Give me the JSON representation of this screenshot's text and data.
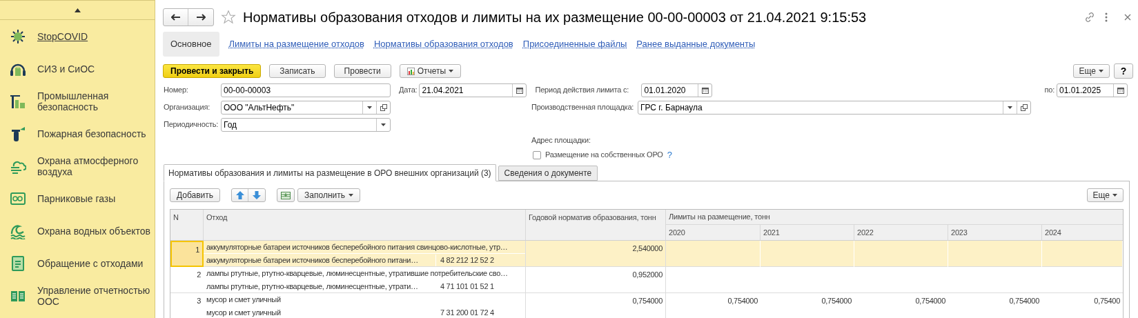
{
  "sidebar": {
    "items": [
      {
        "label": "StopCOVID",
        "selected": true
      },
      {
        "label": "СИЗ и СиОС",
        "selected": false
      },
      {
        "label": "Промышленная безопасность",
        "selected": false
      },
      {
        "label": "Пожарная безопасность",
        "selected": false
      },
      {
        "label": "Охрана атмосферного воздуха",
        "selected": false
      },
      {
        "label": "Парниковые газы",
        "selected": false
      },
      {
        "label": "Охрана водных объектов",
        "selected": false
      },
      {
        "label": "Обращение с отходами",
        "selected": false
      },
      {
        "label": "Управление отчетностью ООС",
        "selected": false
      }
    ]
  },
  "window": {
    "title": "Нормативы образования отходов и лимиты на их размещение 00-00-00003 от 21.04.2021 9:15:53"
  },
  "nav_tabs": [
    {
      "label": "Основное",
      "selected": true
    },
    {
      "label": "Лимиты на размещение отходов",
      "selected": false
    },
    {
      "label": "Нормативы образования отходов",
      "selected": false
    },
    {
      "label": "Присоединенные файлы",
      "selected": false
    },
    {
      "label": "Ранее выданные документы",
      "selected": false
    }
  ],
  "toolbar": {
    "buttons": [
      {
        "label": "Провести и закрыть",
        "kind": "default"
      },
      {
        "label": "Записать",
        "kind": "plain"
      },
      {
        "label": "Провести",
        "kind": "plain"
      },
      {
        "label": "Отчеты",
        "kind": "menu"
      }
    ],
    "more": "Еще",
    "help": "?"
  },
  "fields": {
    "number": {
      "label": "Номер:",
      "value": "00-00-00003"
    },
    "date": {
      "label": "Дата:",
      "value": "21.04.2021"
    },
    "period_from": {
      "label": "Период действия лимита с:",
      "value": "01.01.2020"
    },
    "period_to": {
      "label": "по:",
      "value": "01.01.2025"
    },
    "organization": {
      "label": "Организация:",
      "value": "ООО  \"АльтНефть\""
    },
    "site": {
      "label": "Производственная площадка:",
      "value": "ГРС г. Барнаула"
    },
    "periodicity": {
      "label": "Периодичность:",
      "value": "Год"
    },
    "address": {
      "label": "Адрес площадки:"
    },
    "own_placement": {
      "label": "Размещение на собственных ОРО",
      "checked": false,
      "help": "?"
    }
  },
  "table_tabs": [
    {
      "label": "Нормативы образования и лимиты на размещение в ОРО внешних организаций (3)",
      "selected": true
    },
    {
      "label": "Сведения о документе",
      "selected": false
    }
  ],
  "table_toolbar": {
    "add": "Добавить",
    "fill": "Заполнить",
    "more": "Еще"
  },
  "table": {
    "columns": [
      "N",
      "Отход",
      "Годовой норматив образования, тонн"
    ],
    "group": "Лимиты на размещение, тонн",
    "years": [
      "2020",
      "2021",
      "2022",
      "2023",
      "2024"
    ],
    "rows": [
      {
        "n": "1",
        "waste": "аккумуляторные батареи источников бесперебойного питания свинцово-кислотные, утр…",
        "waste_short": "аккумуляторные батареи источников бесперебойного питани…",
        "code": "4 82 212 12 52 2",
        "annual": "2,540000",
        "limits": [],
        "selected": true
      },
      {
        "n": "2",
        "waste": "лампы ртутные, ртутно-кварцевые, люминесцентные, утратившие потребительские сво…",
        "waste_short": "лампы ртутные, ртутно-кварцевые, люминесцентные, утрати…",
        "code": "4 71 101 01 52 1",
        "annual": "0,952000",
        "limits": [],
        "selected": false
      },
      {
        "n": "3",
        "waste": "мусор и смет уличный",
        "waste_short": "мусор и смет уличный",
        "code": "7 31 200 01 72 4",
        "annual": "0,754000",
        "limits": [
          "0,754000",
          "0,754000",
          "0,754000",
          "0,754000",
          "0,75400"
        ],
        "selected": false
      }
    ]
  }
}
